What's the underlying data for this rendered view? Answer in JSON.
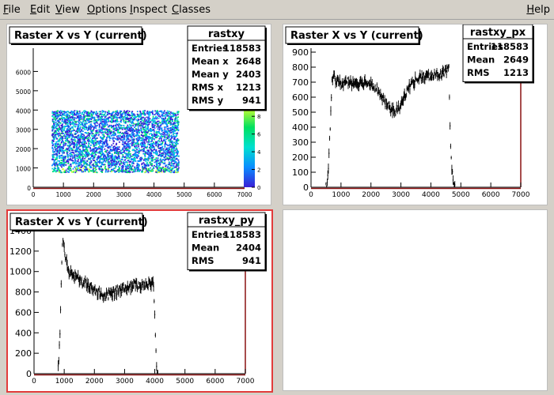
{
  "menu": {
    "items": [
      {
        "id": "file",
        "label": "File"
      },
      {
        "id": "edit",
        "label": "Edit"
      },
      {
        "id": "view",
        "label": "View"
      },
      {
        "id": "options",
        "label": "Options"
      },
      {
        "id": "inspect",
        "label": "Inspect"
      },
      {
        "id": "classes",
        "label": "Classes"
      }
    ],
    "help": "Help"
  },
  "pads": {
    "top_left": {
      "title": "Raster X vs Y (current)",
      "stats": {
        "name": "rastxy",
        "rows": [
          {
            "label": "Entries",
            "value": "118583"
          },
          {
            "label": "Mean x",
            "value": "2648"
          },
          {
            "label": "Mean y",
            "value": "2403"
          },
          {
            "label": "RMS x",
            "value": "1213"
          },
          {
            "label": "RMS y",
            "value": "941"
          }
        ]
      }
    },
    "top_right": {
      "title": "Raster X vs Y (current)",
      "stats": {
        "name": "rastxy_px",
        "rows": [
          {
            "label": "Entries",
            "value": "118583"
          },
          {
            "label": "Mean",
            "value": "2649"
          },
          {
            "label": "RMS",
            "value": "1213"
          }
        ]
      }
    },
    "bottom_left": {
      "title": "Raster X vs Y (current)",
      "stats": {
        "name": "rastxy_py",
        "rows": [
          {
            "label": "Entries",
            "value": "118583"
          },
          {
            "label": "Mean",
            "value": "2404"
          },
          {
            "label": "RMS",
            "value": "941"
          }
        ]
      }
    }
  },
  "chart_data": [
    {
      "type": "heatmap",
      "name": "rastxy",
      "title": "Raster X vs Y (current)",
      "xlim": [
        0,
        7000
      ],
      "ylim": [
        0,
        7000
      ],
      "x_ticks": [
        0,
        1000,
        2000,
        3000,
        4000,
        5000,
        6000,
        7000
      ],
      "y_ticks": [
        0,
        1000,
        2000,
        3000,
        4000,
        5000,
        6000
      ],
      "filled_region": {
        "x": [
          600,
          4800
        ],
        "y": [
          800,
          4000
        ]
      },
      "hole_center": [
        2700,
        2300
      ],
      "colorbar": {
        "ticks": [
          0,
          2,
          4,
          6,
          8
        ],
        "max": 9,
        "colors": [
          "#3a1fd6",
          "#0a8cff",
          "#00e0d0",
          "#00e060",
          "#d0ff30"
        ]
      }
    },
    {
      "type": "line",
      "name": "rastxy_px",
      "title": "Raster X vs Y (current)",
      "xlim": [
        0,
        7000
      ],
      "ylim": [
        0,
        900
      ],
      "x_ticks": [
        0,
        1000,
        2000,
        3000,
        4000,
        5000,
        6000,
        7000
      ],
      "y_ticks": [
        0,
        100,
        200,
        300,
        400,
        500,
        600,
        700,
        800,
        900
      ],
      "x": [
        500,
        550,
        600,
        650,
        700,
        750,
        800,
        900,
        1000,
        1200,
        1400,
        1600,
        1800,
        2000,
        2200,
        2400,
        2600,
        2800,
        3000,
        3200,
        3400,
        3600,
        3800,
        4000,
        4200,
        4400,
        4600,
        4650,
        4700,
        4750,
        4800
      ],
      "y": [
        0,
        30,
        200,
        450,
        700,
        780,
        720,
        700,
        690,
        705,
        700,
        695,
        700,
        690,
        660,
        580,
        530,
        505,
        540,
        650,
        700,
        730,
        735,
        740,
        750,
        760,
        780,
        300,
        140,
        20,
        5
      ]
    },
    {
      "type": "line",
      "name": "rastxy_py",
      "title": "Raster X vs Y (current)",
      "xlim": [
        0,
        7000
      ],
      "ylim": [
        0,
        1400
      ],
      "x_ticks": [
        0,
        1000,
        2000,
        3000,
        4000,
        5000,
        6000,
        7000
      ],
      "y_ticks": [
        0,
        200,
        400,
        600,
        800,
        1000,
        1200,
        1400
      ],
      "x": [
        800,
        850,
        900,
        950,
        1000,
        1100,
        1200,
        1400,
        1600,
        1800,
        2000,
        2200,
        2400,
        2600,
        2800,
        3000,
        3200,
        3400,
        3600,
        3800,
        3950,
        4000,
        4050,
        4100
      ],
      "y": [
        50,
        300,
        900,
        1300,
        1200,
        1050,
        980,
        950,
        900,
        860,
        820,
        780,
        760,
        790,
        820,
        850,
        860,
        870,
        880,
        870,
        880,
        600,
        100,
        10
      ]
    }
  ]
}
